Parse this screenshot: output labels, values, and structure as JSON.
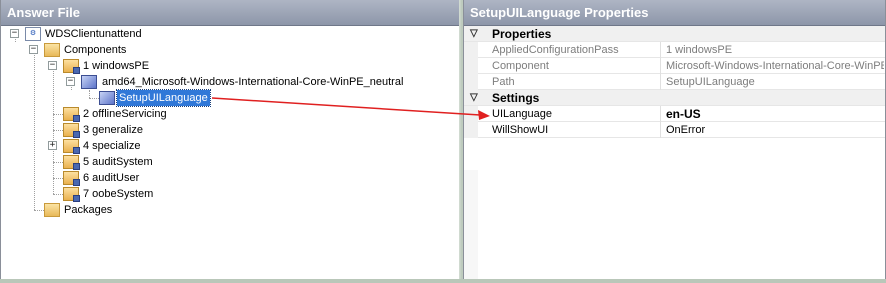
{
  "left_panel": {
    "title": "Answer File"
  },
  "tree": {
    "root": "WDSClientunattend",
    "components": "Components",
    "windowsPE": "1 windowsPE",
    "component": "amd64_Microsoft-Windows-International-Core-WinPE_neutral",
    "setting": "SetupUILanguage",
    "passes": [
      "2 offlineServicing",
      "3 generalize",
      "4 specialize",
      "5 auditSystem",
      "6 auditUser",
      "7 oobeSystem"
    ],
    "packages": "Packages"
  },
  "right_panel": {
    "title": "SetupUILanguage Properties"
  },
  "properties": {
    "category": "Properties",
    "rows": [
      {
        "name": "AppliedConfigurationPass",
        "value": "1 windowsPE"
      },
      {
        "name": "Component",
        "value": "Microsoft-Windows-International-Core-WinPE"
      },
      {
        "name": "Path",
        "value": "SetupUILanguage"
      }
    ]
  },
  "settings": {
    "category": "Settings",
    "rows": [
      {
        "name": "UILanguage",
        "value": "en-US"
      },
      {
        "name": "WillShowUI",
        "value": "OnError"
      }
    ]
  },
  "colors": {
    "header": "#8d96a9",
    "selection": "#3078d8",
    "arrow": "#e02020"
  }
}
